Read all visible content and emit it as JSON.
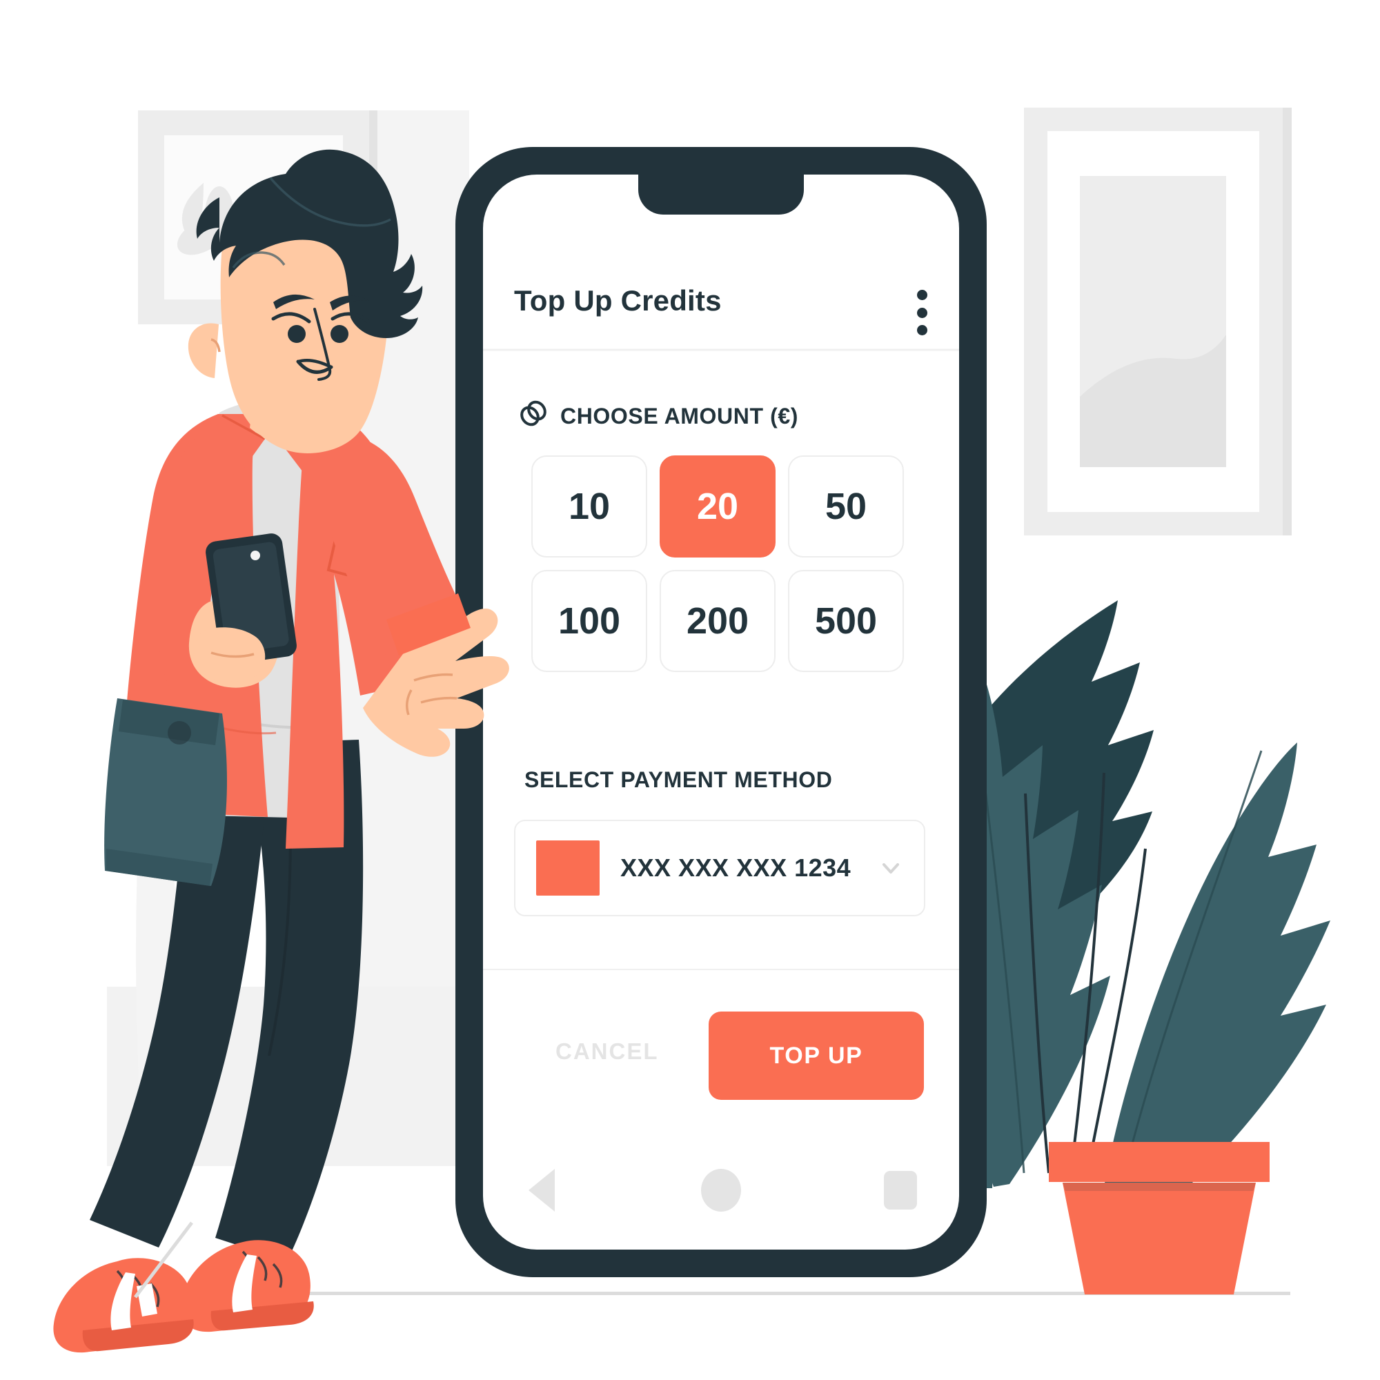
{
  "scene": {
    "description": "Flat illustration: man leaning on a giant smartphone showing a Top Up Credits screen, potted plant right, picture frames on wall",
    "colors": {
      "accent_orange": "#FA6E52",
      "dark_navy": "#22333B",
      "skin": "#FFC9A3",
      "shirt_orange": "#F8705A",
      "tee_gray": "#E0E0E0",
      "bag_teal": "#3E6069",
      "leaf_light": "#3A6068",
      "leaf_dark": "#24424A",
      "frame_gray": "#EBEBEB",
      "wall_gray": "#EFEFEF",
      "phone_body": "#22333B",
      "screen_white": "#FFFFFF",
      "border_gray": "#EDEDED",
      "muted_gray": "#E4E4E4"
    }
  },
  "phone": {
    "header": {
      "title": "Top Up Credits",
      "menu_icon": "kebab-menu-icon"
    },
    "amount_section": {
      "icon": "stacked-coins-icon",
      "label": "CHOOSE AMOUNT (€)",
      "options": [
        {
          "value": "10",
          "selected": false
        },
        {
          "value": "20",
          "selected": true
        },
        {
          "value": "50",
          "selected": false
        },
        {
          "value": "100",
          "selected": false
        },
        {
          "value": "200",
          "selected": false
        },
        {
          "value": "500",
          "selected": false
        }
      ]
    },
    "payment_section": {
      "label": "SELECT PAYMENT METHOD",
      "card": {
        "brand_swatch_color": "#FA6E52",
        "number": "XXX XXX XXX 1234",
        "dropdown_icon": "chevron-down-icon"
      }
    },
    "actions": {
      "cancel_label": "CANCEL",
      "topup_label": "TOP UP"
    },
    "navbar": {
      "back_icon": "back-triangle-icon",
      "home_icon": "home-circle-icon",
      "recents_icon": "recents-square-icon"
    }
  }
}
